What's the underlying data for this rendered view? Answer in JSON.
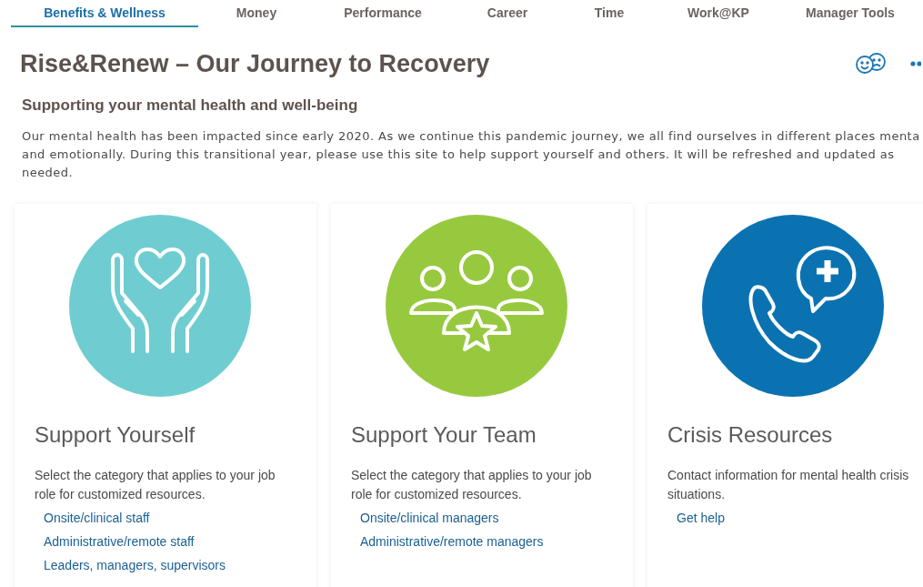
{
  "tabs": [
    {
      "label": "Benefits & Wellness",
      "selected": true
    },
    {
      "label": "Money",
      "selected": false
    },
    {
      "label": "Performance",
      "selected": false
    },
    {
      "label": "Career",
      "selected": false
    },
    {
      "label": "Time",
      "selected": false
    },
    {
      "label": "Work@KP",
      "selected": false
    },
    {
      "label": "Manager Tools",
      "selected": false
    }
  ],
  "page_title": "Rise&Renew – Our Journey to Recovery",
  "subtitle": "Supporting your mental health and well-being",
  "intro": "Our mental health has been impacted since early 2020. As we continue this pandemic journey, we all find ourselves in different places menta\nand emotionally. During this transitional year, please use this site to help support yourself and others. It will be refreshed and updated as\nneeded.",
  "cards": [
    {
      "kind": "hands",
      "color": "#6fcdd1",
      "title": "Support Yourself",
      "description": "Select the category that applies to your job role for customized resources.",
      "links": [
        "Onsite/clinical staff",
        "Administrative/remote staff",
        "Leaders, managers, supervisors"
      ]
    },
    {
      "kind": "team",
      "color": "#97c93f",
      "title": "Support Your Team",
      "description": "Select the category that applies to your job role for customized resources.",
      "links": [
        "Onsite/clinical managers",
        "Administrative/remote managers"
      ]
    },
    {
      "kind": "phone",
      "color": "#0b72b2",
      "title": "Crisis Resources",
      "description": "Contact information for mental health crisis situations.",
      "links": [
        "Get help"
      ]
    }
  ]
}
